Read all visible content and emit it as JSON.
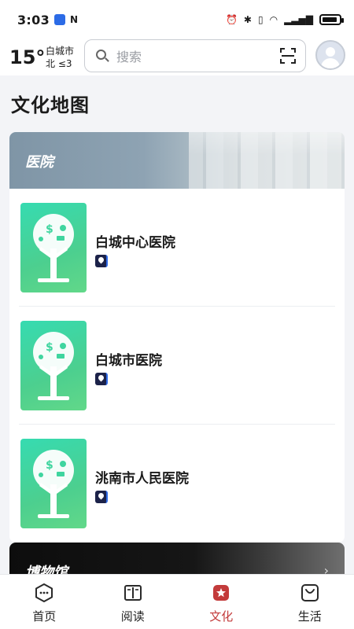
{
  "status_bar": {
    "time": "3:03",
    "nfc_label": "N"
  },
  "header": {
    "temperature": "15°",
    "city": "白城市",
    "wind": "北 ≤3",
    "search_placeholder": "搜索"
  },
  "page_title": "文化地图",
  "sections": {
    "hospitals": {
      "title": "医院",
      "items": [
        {
          "name": "白城中心医院"
        },
        {
          "name": "白城市医院"
        },
        {
          "name": "洮南市人民医院"
        }
      ]
    },
    "museums": {
      "title": "博物馆",
      "chevron": "›"
    }
  },
  "bottom_nav": {
    "items": [
      {
        "label": "首页",
        "icon": "home-hexagon-icon"
      },
      {
        "label": "阅读",
        "icon": "book-icon"
      },
      {
        "label": "文化",
        "icon": "culture-star-icon",
        "active": true
      },
      {
        "label": "生活",
        "icon": "bag-icon"
      }
    ]
  },
  "colors": {
    "accent": "#c33b3b",
    "thumb_green": "#36dbb1"
  }
}
